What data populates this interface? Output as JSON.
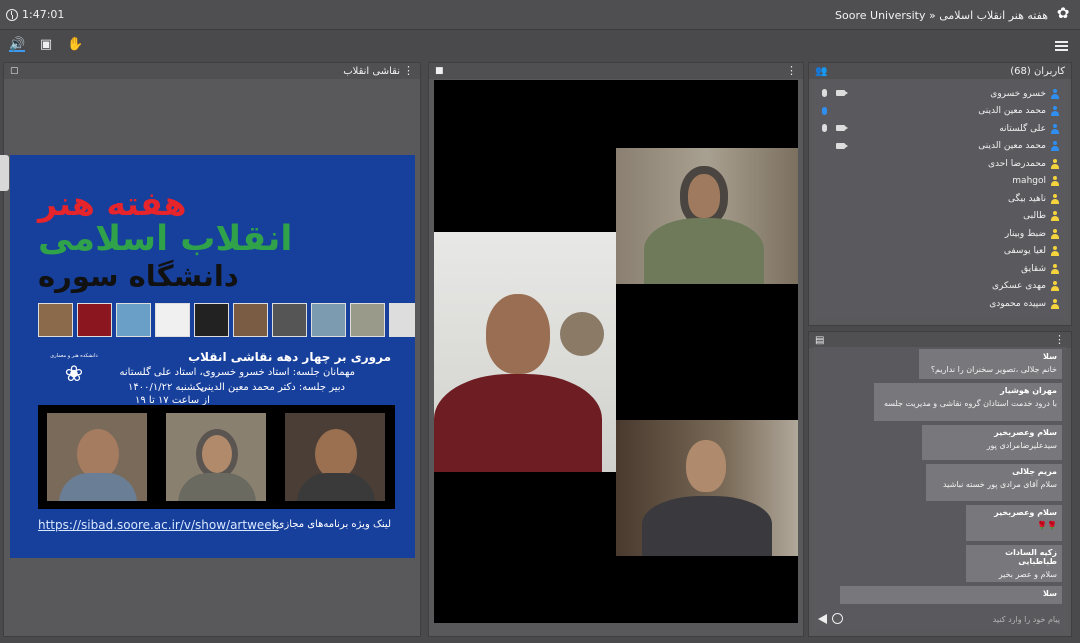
{
  "topbar": {
    "timer": "1:47:01",
    "breadcrumb": "Soore University » هفته هنر انقلاب اسلامی"
  },
  "presentation": {
    "title": "نقاشی انقلاب",
    "slide": {
      "banner_line1": "هفته هنر",
      "banner_line2": "انقلاب اسلامی",
      "banner_line3": "دانشگاه سوره",
      "session_title": "مروری بر چهار دهه نقاشی انقلاب",
      "guests": "مهمانان جلسه: استاد خسرو خسروی، استاد علی گلستانه",
      "secretary": "دبیر جلسه: دکتر محمد معین الدینی",
      "date": "یکشنبه ۱۴۰۰/۱/۲۲",
      "time": "از ساعت ۱۷ تا ۱۹",
      "link": "https://sibad.soore.ac.ir/v/show/artweek",
      "link_label": "لینک ویژه برنامه‌های مجازی:",
      "emblem_caption": "دانشکده هنر و معماری"
    }
  },
  "users": {
    "title": "کاربران (68)",
    "list": [
      {
        "name": "خسرو خسروی",
        "mic": "muted",
        "cam": true,
        "color": "#2f8ef0"
      },
      {
        "name": "محمد معین الدینی",
        "mic": "active",
        "cam": false,
        "color": "#2f8ef0"
      },
      {
        "name": "علی گلستانه",
        "mic": "muted",
        "cam": true,
        "color": "#2f8ef0"
      },
      {
        "name": "محمد معین الدینی",
        "mic": "none",
        "cam": true,
        "color": "#2f8ef0"
      },
      {
        "name": "محمدرضا احدی",
        "mic": "none",
        "cam": false,
        "color": "#f5d33d"
      },
      {
        "name": "mahgol",
        "mic": "none",
        "cam": false,
        "color": "#f5d33d"
      },
      {
        "name": "ناهید بیگی",
        "mic": "none",
        "cam": false,
        "color": "#f5d33d"
      },
      {
        "name": "طالبی",
        "mic": "none",
        "cam": false,
        "color": "#f5d33d"
      },
      {
        "name": "ضبط وبینار",
        "mic": "none",
        "cam": false,
        "color": "#f5d33d"
      },
      {
        "name": "لعیا یوسفی",
        "mic": "none",
        "cam": false,
        "color": "#f5d33d"
      },
      {
        "name": "شقایق",
        "mic": "none",
        "cam": false,
        "color": "#f5d33d"
      },
      {
        "name": "مهدی عسکری",
        "mic": "none",
        "cam": false,
        "color": "#f5d33d"
      },
      {
        "name": "سپیده محمودی",
        "mic": "none",
        "cam": false,
        "color": "#f5d33d"
      }
    ]
  },
  "chat": {
    "messages": [
      {
        "who": "سلا",
        "text": "خانم جلالی ،تصویر سخنران را نداریم؟"
      },
      {
        "who": "مهران هوشیار",
        "text": "با درود خدمت استادان گروه نقاشی و مدیریت جلسه"
      },
      {
        "who": "سلام وعصربخیر",
        "text": "سیدعلیرضامرادی پور"
      },
      {
        "who": "مریم جلالی",
        "text": "سلام آقای مرادی پور خسته نباشید"
      },
      {
        "who": "سلام وعصربخیر",
        "text": "🌹🌹"
      },
      {
        "who": "زکیه السادات طباطبایی",
        "text": "سلام و عصر بخیر"
      },
      {
        "who": "سلا",
        "text": ""
      }
    ],
    "input_placeholder": "پیام خود را وارد کنید"
  },
  "icons": {
    "audio": "speaker-icon",
    "screen": "presentation-icon",
    "hand": "raise-hand-icon",
    "menu": "hamburger-icon"
  },
  "colors": {
    "accent": "#2f8ef0",
    "guest": "#f5d33d",
    "slide_bg": "#173f9c",
    "banner_red": "#e5242b",
    "banner_green": "#2fa24a"
  }
}
